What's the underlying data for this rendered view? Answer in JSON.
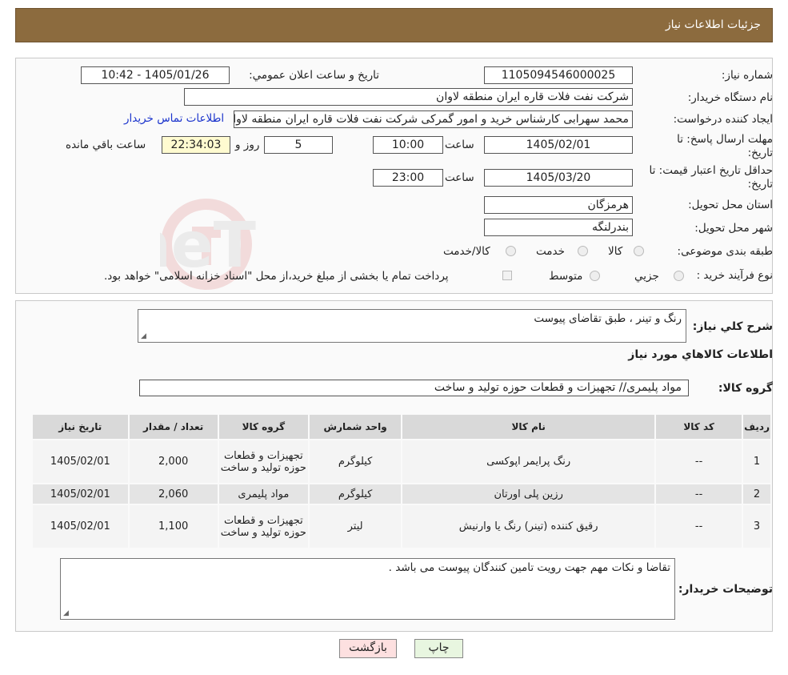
{
  "header": {
    "title": "جزئیات اطلاعات نیاز"
  },
  "form": {
    "need_number_label": "شماره نیاز:",
    "need_number": "1105094546000025",
    "announce_label": "تاریخ و ساعت اعلان عمومي:",
    "announce_value": "1405/01/26 - 10:42",
    "buyer_org_label": "نام دستگاه خريدار:",
    "buyer_org": "شرکت نفت فلات قاره ایران منطقه لاوان",
    "creator_label": "ایجاد کننده درخواست:",
    "creator": "محمد سهرابی کارشناس خرید و امور گمرکی شرکت نفت فلات قاره ایران منطقه لاوان",
    "contact_link": "اطلاعات تماس خریدار",
    "deadline_label": "مهلت ارسال پاسخ: تا تاریخ:",
    "deadline_date": "1405/02/01",
    "time_label": "ساعت",
    "deadline_time": "10:00",
    "days": "5",
    "days_label": "روز و",
    "remaining": "22:34:03",
    "remaining_label": "ساعت باقي مانده",
    "validity_label": "حداقل تاریخ اعتبار قیمت: تا تاریخ:",
    "validity_date": "1405/03/20",
    "validity_time": "23:00",
    "province_label": "استان محل تحویل:",
    "province": "هرمزگان",
    "city_label": "شهر محل تحویل:",
    "city": "بندرلنگه",
    "category_label": "طبقه بندی موضوعی:",
    "category_options": [
      "کالا",
      "خدمت",
      "کالا/خدمت"
    ],
    "process_label": "نوع فرآیند خرید :",
    "process_options": [
      "جزیي",
      "متوسط"
    ],
    "payment_note": "پرداخت تمام یا بخشی از مبلغ خرید،از محل \"اسناد خزانه اسلامی\" خواهد بود."
  },
  "summary": {
    "label": "شرح کلي نياز:",
    "value": "رنگ و تینر ، طبق تقاضای پیوست",
    "goods_title": "اطلاعات کالاهاي مورد نياز",
    "group_label": "گروه کالا:",
    "group_value": "مواد پلیمری// تجهیزات و قطعات حوزه تولید و ساخت"
  },
  "table": {
    "headers": [
      "رديف",
      "کد کالا",
      "نام کالا",
      "واحد شمارش",
      "گروه کالا",
      "تعداد / مقدار",
      "تاريخ نياز"
    ],
    "rows": [
      [
        "1",
        "--",
        "رنگ پرایمر اپوکسی",
        "کیلوگرم",
        "تجهیزات و قطعات حوزه تولید و ساخت",
        "2,000",
        "1405/02/01"
      ],
      [
        "2",
        "--",
        "رزین پلی اورتان",
        "کیلوگرم",
        "مواد پلیمری",
        "2,060",
        "1405/02/01"
      ],
      [
        "3",
        "--",
        "رقیق کننده (تینر) رنگ یا وارنیش",
        "لیتر",
        "تجهیزات و قطعات حوزه تولید و ساخت",
        "1,100",
        "1405/02/01"
      ]
    ]
  },
  "notes": {
    "label": "توضیحات خریدار:",
    "value": "تقاضا و نکات مهم جهت رویت تامین کنندگان پیوست می باشد ."
  },
  "buttons": {
    "print": "چاپ",
    "back": "بازگشت"
  },
  "watermark": {
    "text": "AriaTender.neT"
  },
  "colors": {
    "header": "#8c6b3e",
    "link": "#1a33cc",
    "remaining_bg": "#fffbd0",
    "print_btn": "#e8f6e0",
    "back_btn": "#fde0e0"
  }
}
